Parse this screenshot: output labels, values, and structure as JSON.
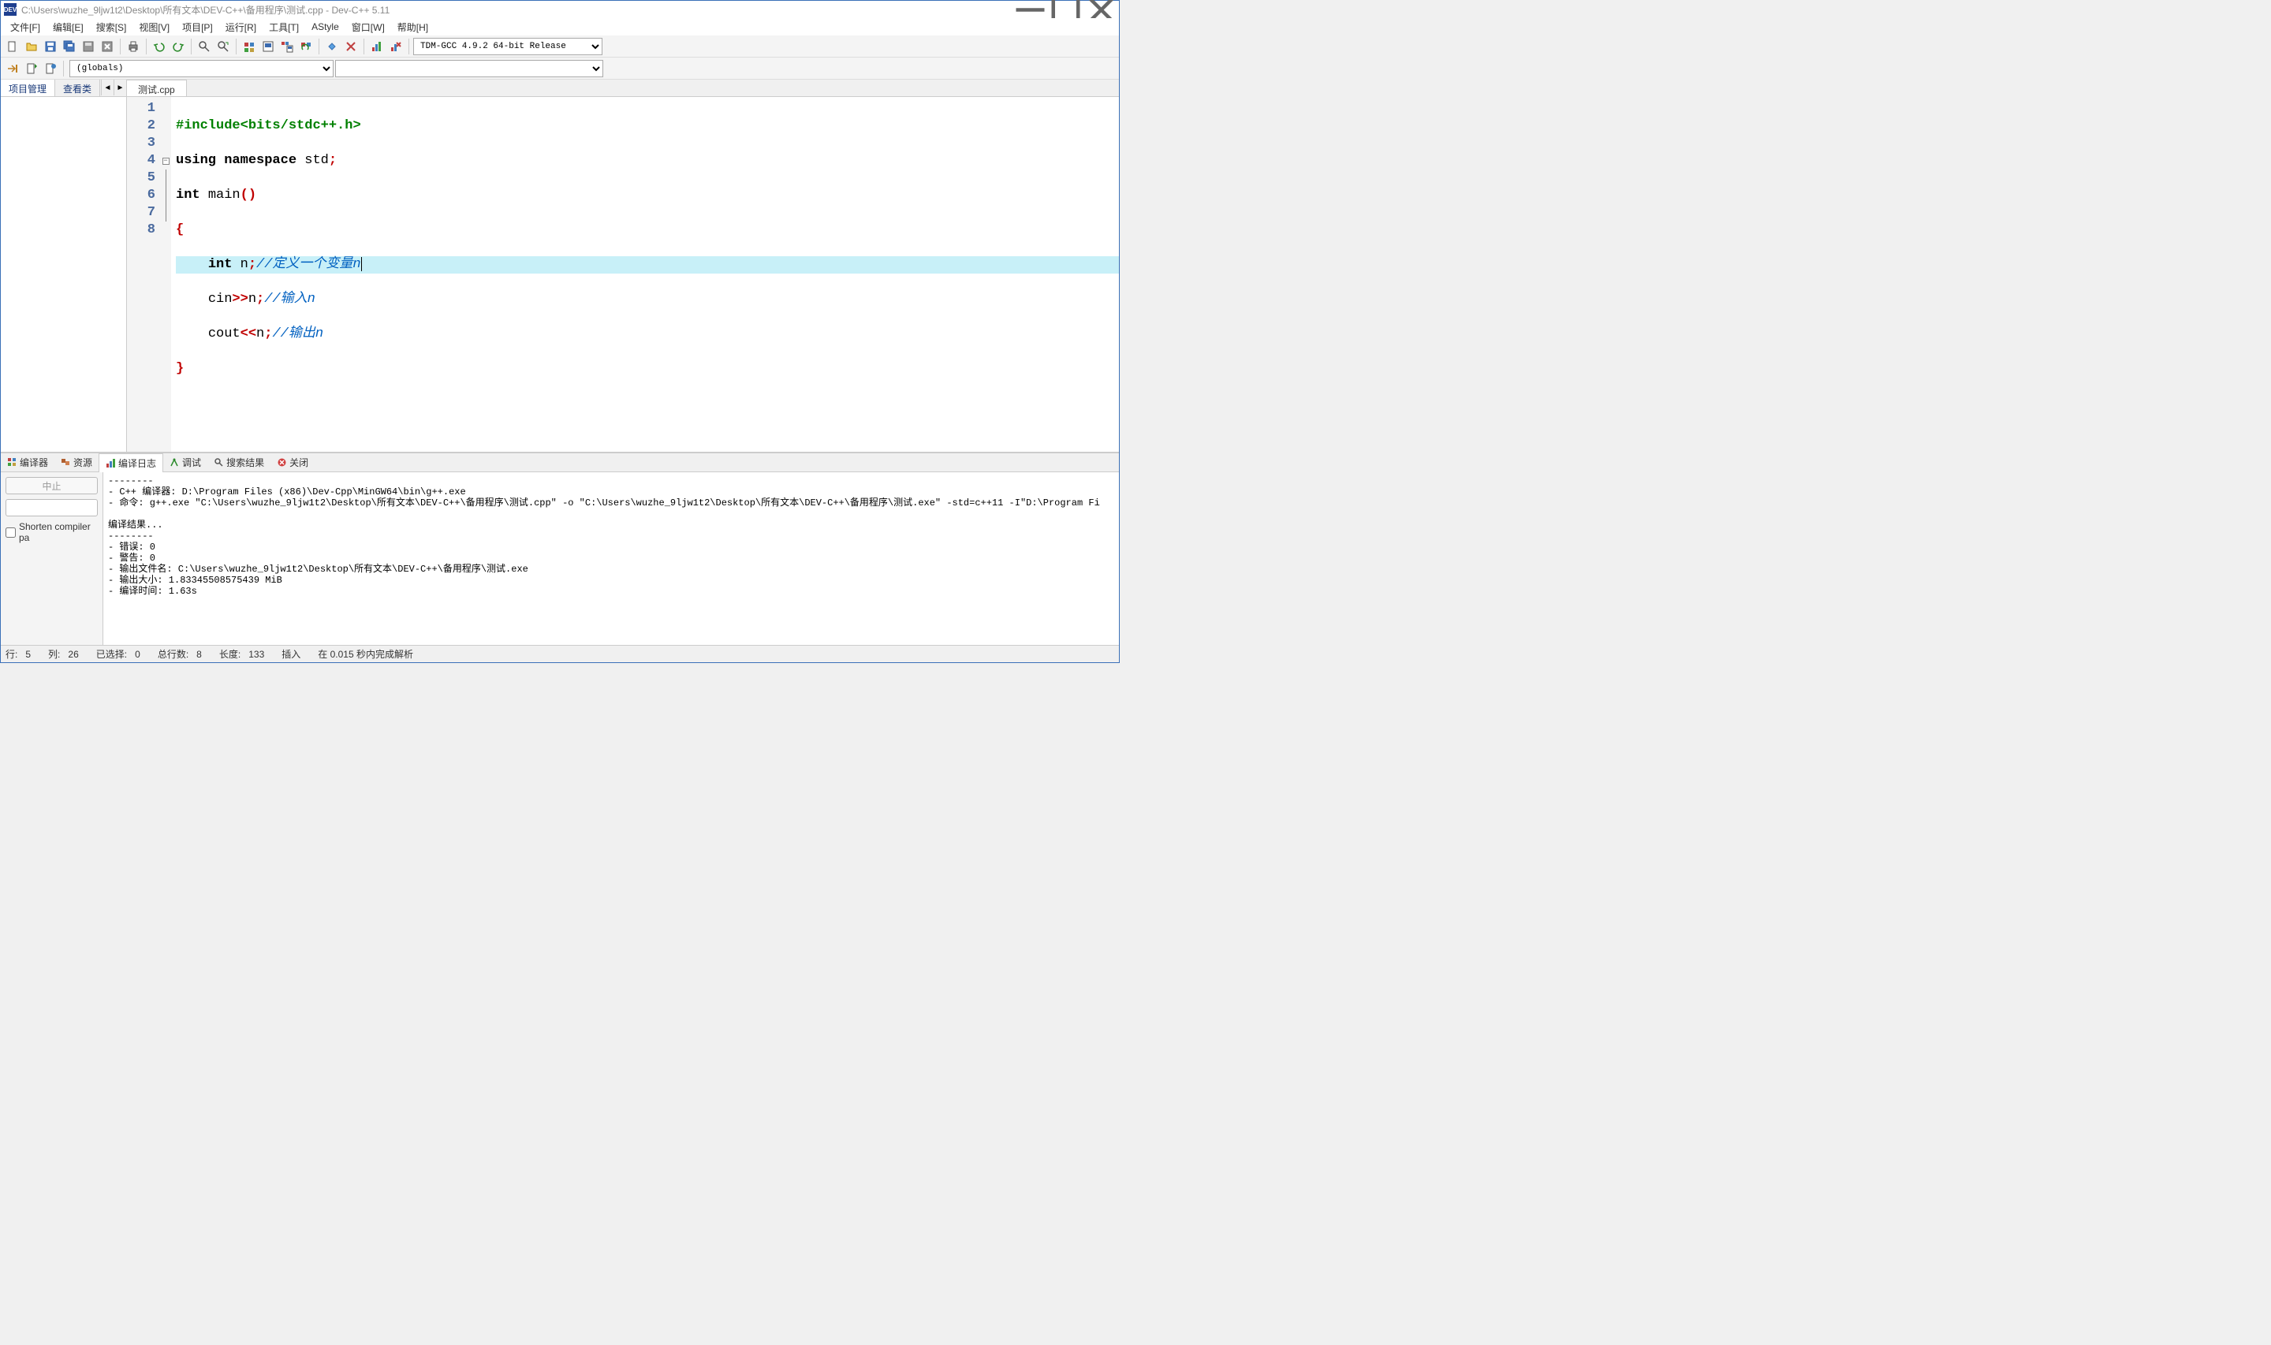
{
  "title": "C:\\Users\\wuzhe_9ljw1t2\\Desktop\\所有文本\\DEV-C++\\备用程序\\测试.cpp - Dev-C++ 5.11",
  "app_icon_text": "DEV",
  "menubar": [
    "文件[F]",
    "编辑[E]",
    "搜索[S]",
    "视图[V]",
    "项目[P]",
    "运行[R]",
    "工具[T]",
    "AStyle",
    "窗口[W]",
    "帮助[H]"
  ],
  "compiler_select": "TDM-GCC 4.9.2 64-bit Release",
  "globals_select": "(globals)",
  "side_tabs": {
    "a": "项目管理",
    "b": "查看类"
  },
  "file_tab": "测试.cpp",
  "code": {
    "lines": [
      "1",
      "2",
      "3",
      "4",
      "5",
      "6",
      "7",
      "8"
    ],
    "l1_pp": "#include",
    "l1_inc": "<bits/stdc++.h>",
    "l2_a": "using",
    "l2_b": "namespace",
    "l2_c": "std",
    "l2_d": ";",
    "l3_a": "int",
    "l3_b": "main",
    "l3_c": "()",
    "l4": "{",
    "l5_pad": "    ",
    "l5_a": "int",
    "l5_b": " n",
    "l5_c": ";",
    "l5_cm": "//定义一个变量n",
    "l6_pad": "    ",
    "l6_a": "cin",
    "l6_b": ">>",
    "l6_c": "n",
    "l6_d": ";",
    "l6_cm": "//输入n",
    "l7_pad": "    ",
    "l7_a": "cout",
    "l7_b": "<<",
    "l7_c": "n",
    "l7_d": ";",
    "l7_cm": "//输出n",
    "l8": "}"
  },
  "bottom_tabs": {
    "compiler": "编译器",
    "resource": "资源",
    "log": "编译日志",
    "debug": "调试",
    "search": "搜索结果",
    "close": "关闭"
  },
  "bottom_left": {
    "stop": "中止",
    "shorten": "Shorten compiler pa"
  },
  "log": "--------\n- C++ 编译器: D:\\Program Files (x86)\\Dev-Cpp\\MinGW64\\bin\\g++.exe\n- 命令: g++.exe \"C:\\Users\\wuzhe_9ljw1t2\\Desktop\\所有文本\\DEV-C++\\备用程序\\测试.cpp\" -o \"C:\\Users\\wuzhe_9ljw1t2\\Desktop\\所有文本\\DEV-C++\\备用程序\\测试.exe\" -std=c++11 -I\"D:\\Program Fi\n\n编译结果...\n--------\n- 错误: 0\n- 警告: 0\n- 输出文件名: C:\\Users\\wuzhe_9ljw1t2\\Desktop\\所有文本\\DEV-C++\\备用程序\\测试.exe\n- 输出大小: 1.83345508575439 MiB\n- 编译时间: 1.63s",
  "status": {
    "row_lbl": "行:",
    "row": "5",
    "col_lbl": "列:",
    "col": "26",
    "sel_lbl": "已选择:",
    "sel": "0",
    "tot_lbl": "总行数:",
    "tot": "8",
    "len_lbl": "长度:",
    "len": "133",
    "ins": "插入",
    "parse": "在 0.015 秒内完成解析"
  }
}
